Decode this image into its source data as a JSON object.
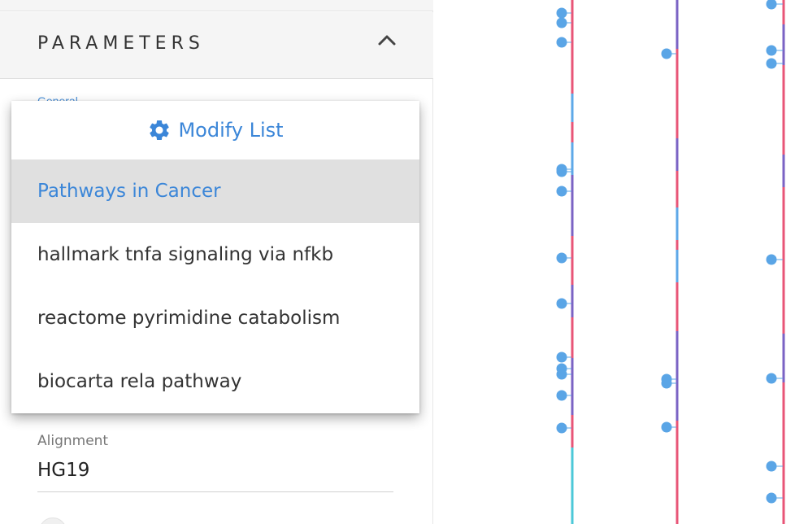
{
  "parameters": {
    "title": "PARAMETERS",
    "general_label": "General"
  },
  "dropdown": {
    "modify_label": "Modify List",
    "items": [
      {
        "label": "Pathways in Cancer",
        "active": true
      },
      {
        "label": "hallmark tnfa signaling via nfkb",
        "active": false
      },
      {
        "label": "reactome pyrimidine catabolism",
        "active": false
      },
      {
        "label": "biocarta rela pathway",
        "active": false
      }
    ]
  },
  "alignment": {
    "label": "Alignment",
    "value": "HG19"
  },
  "colors": {
    "accent": "#3b86d8",
    "track_pink": "#e85577",
    "track_purple": "#7b63c4",
    "track_blue": "#5ea8e8",
    "track_cyan": "#4cc8d8",
    "marker": "#5aa5e6"
  }
}
